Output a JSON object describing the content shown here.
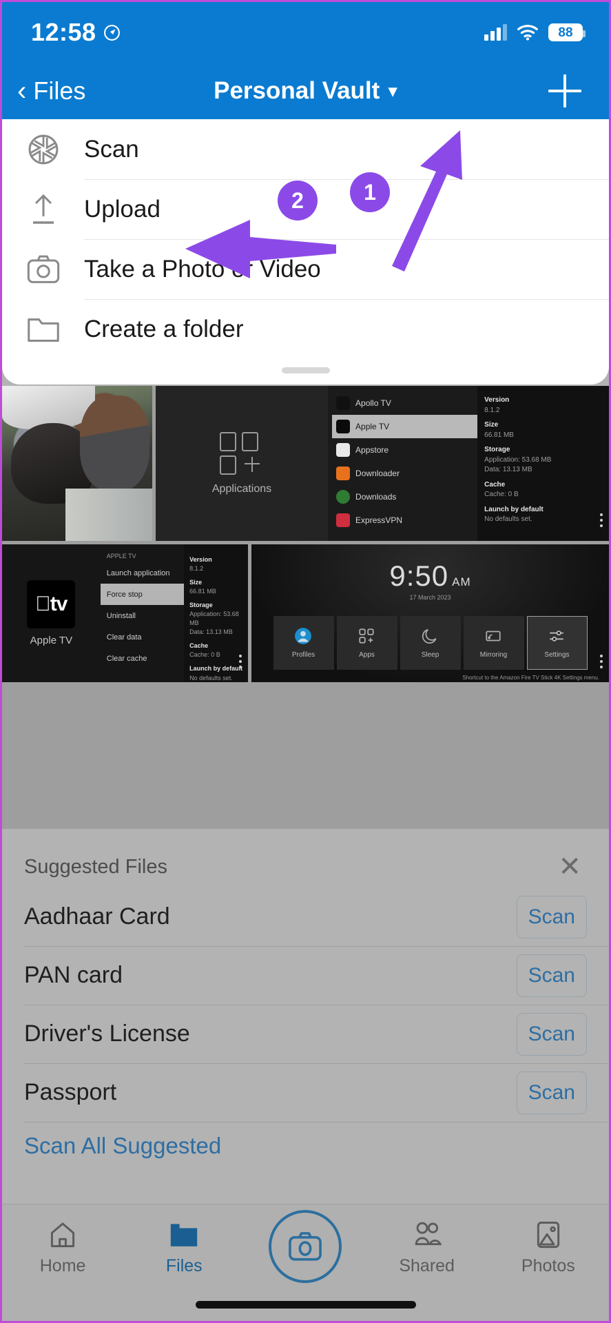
{
  "status_bar": {
    "time": "12:58",
    "location_icon": "location-arrow-icon",
    "signal_icon": "cellular-signal-icon",
    "wifi_icon": "wifi-icon",
    "battery_level": "88"
  },
  "nav_bar": {
    "back_label": "Files",
    "back_icon": "chevron-left-icon",
    "title": "Personal Vault",
    "title_chevron": "chevron-down-icon",
    "add_icon": "plus-icon",
    "background_color": "#0a7bd0"
  },
  "action_sheet": {
    "items": [
      {
        "label": "Scan",
        "icon": "aperture-scan-icon"
      },
      {
        "label": "Upload",
        "icon": "upload-arrow-icon"
      },
      {
        "label": "Take a Photo or Video",
        "icon": "camera-icon"
      },
      {
        "label": "Create a folder",
        "icon": "folder-icon"
      }
    ]
  },
  "annotations": {
    "accent_color": "#8b4ae8",
    "markers": [
      {
        "number": "1",
        "points_to": "plus-icon"
      },
      {
        "number": "2",
        "points_to": "upload-menu-item"
      }
    ]
  },
  "thumbnails": {
    "photo": {
      "caption": ""
    },
    "apps_screen": {
      "panel_title": "Applications",
      "apps": [
        {
          "name": "Apollo TV",
          "color": "#111111"
        },
        {
          "name": "Apple TV",
          "color": "#0b0b0b",
          "selected": true
        },
        {
          "name": "Appstore",
          "color": "#e8e8e8"
        },
        {
          "name": "Downloader",
          "color": "#e8711c"
        },
        {
          "name": "Downloads",
          "color": "#2f7d32"
        },
        {
          "name": "ExpressVPN",
          "color": "#cf2e3f"
        }
      ],
      "details": [
        {
          "key": "Version",
          "value": "8.1.2"
        },
        {
          "key": "Size",
          "value": "66.81 MB"
        },
        {
          "key": "Storage",
          "value": "Application: 53.68 MB\nData: 13.13 MB"
        },
        {
          "key": "Cache",
          "value": "Cache: 0 B"
        },
        {
          "key": "Launch by default",
          "value": "No defaults set."
        }
      ]
    },
    "appletv_screen": {
      "header": "APPLE TV",
      "app_name": "Apple TV",
      "logo_text": "tv",
      "options": [
        "Launch application",
        "Force stop",
        "Uninstall",
        "Clear data",
        "Clear cache"
      ],
      "selected_option": "Force stop",
      "details": [
        {
          "key": "Version",
          "value": "8.1.2"
        },
        {
          "key": "Size",
          "value": "66.81 MB"
        },
        {
          "key": "Storage",
          "value": "Application: 53.68 MB\nData: 13.13 MB"
        },
        {
          "key": "Cache",
          "value": "Cache: 0 B"
        },
        {
          "key": "Launch by default",
          "value": "No defaults set."
        }
      ]
    },
    "firetv_home": {
      "clock": "9:50",
      "meridiem": "AM",
      "date": "17 March 2023",
      "tiles": [
        {
          "label": "Profiles",
          "icon": "profile-avatar-icon"
        },
        {
          "label": "Apps",
          "icon": "apps-grid-icon"
        },
        {
          "label": "Sleep",
          "icon": "moon-icon"
        },
        {
          "label": "Mirroring",
          "icon": "screen-mirror-icon"
        },
        {
          "label": "Settings",
          "icon": "sliders-icon",
          "selected": true
        }
      ],
      "note": "Shortcut to the Amazon Fire TV Stick 4K Settings menu."
    }
  },
  "suggested_files": {
    "title": "Suggested Files",
    "close_icon": "close-x-icon",
    "scan_label": "Scan",
    "rows": [
      {
        "name": "Aadhaar Card",
        "action": "Scan"
      },
      {
        "name": "PAN card",
        "action": "Scan"
      },
      {
        "name": "Driver's License",
        "action": "Scan"
      },
      {
        "name": "Passport",
        "action": "Scan"
      }
    ],
    "scan_all_label": "Scan All Suggested"
  },
  "tab_bar": {
    "tabs": [
      {
        "label": "Home",
        "icon": "home-icon",
        "active": false
      },
      {
        "label": "Files",
        "icon": "folder-filled-icon",
        "active": true
      },
      {
        "label": "Shared",
        "icon": "shared-people-icon",
        "active": false
      },
      {
        "label": "Photos",
        "icon": "photos-image-icon",
        "active": false
      }
    ],
    "center_button": {
      "icon": "camera-icon"
    },
    "active_color": "#1b5f92"
  }
}
